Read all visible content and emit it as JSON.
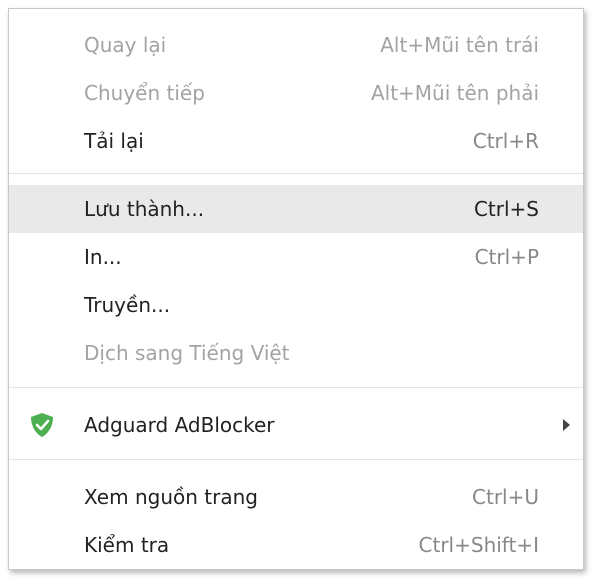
{
  "menu": {
    "items": [
      {
        "label": "Quay lại",
        "shortcut": "Alt+Mũi tên trái",
        "enabled": false
      },
      {
        "label": "Chuyển tiếp",
        "shortcut": "Alt+Mũi tên phải",
        "enabled": false
      },
      {
        "label": "Tải lại",
        "shortcut": "Ctrl+R",
        "enabled": true
      },
      {
        "label": "Lưu thành...",
        "shortcut": "Ctrl+S",
        "enabled": true,
        "highlighted": true
      },
      {
        "label": "In...",
        "shortcut": "Ctrl+P",
        "enabled": true
      },
      {
        "label": "Truyền...",
        "shortcut": "",
        "enabled": true
      },
      {
        "label": "Dịch sang Tiếng Việt",
        "shortcut": "",
        "enabled": false
      },
      {
        "label": "Adguard AdBlocker",
        "icon": "adguard-shield-icon",
        "submenu": true,
        "enabled": true
      },
      {
        "label": "Xem nguồn trang",
        "shortcut": "Ctrl+U",
        "enabled": true
      },
      {
        "label": "Kiểm tra",
        "shortcut": "Ctrl+Shift+I",
        "enabled": true
      }
    ]
  },
  "colors": {
    "highlight": "#e9e9e9",
    "text": "#222222",
    "disabled_text": "#a3a3a3",
    "shortcut_text": "#888888",
    "shield_green": "#4caf50"
  }
}
